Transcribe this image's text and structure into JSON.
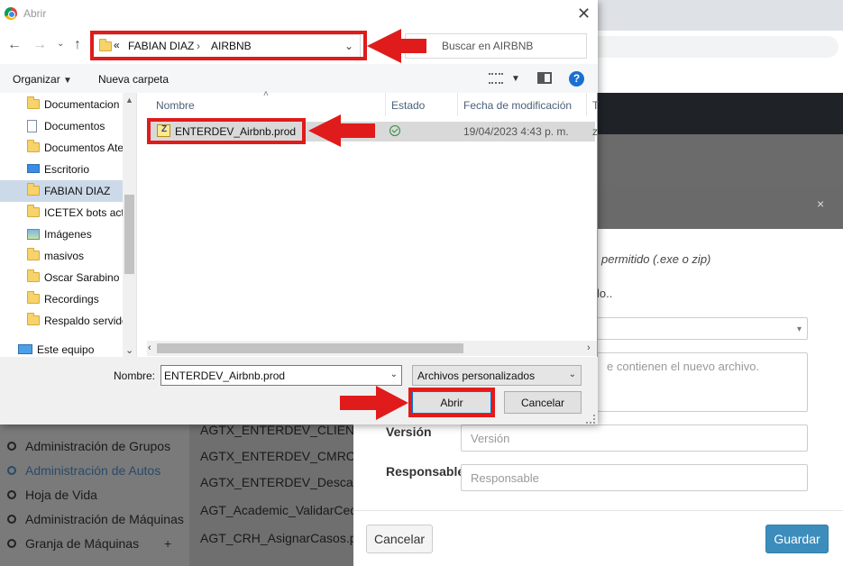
{
  "dialog": {
    "title": "Abrir",
    "path": {
      "prefix": "«",
      "segments": [
        "FABIAN DIAZ",
        "AIRBNB"
      ]
    },
    "search_placeholder": "Buscar en AIRBNB",
    "toolbar": {
      "organize": "Organizar",
      "new_folder": "Nueva carpeta"
    },
    "nav_items": [
      {
        "label": "Documentacion",
        "icon": "folder-icon"
      },
      {
        "label": "Documentos",
        "icon": "document-icon"
      },
      {
        "label": "Documentos Ate",
        "icon": "folder-icon"
      },
      {
        "label": "Escritorio",
        "icon": "desktop-icon"
      },
      {
        "label": "FABIAN DIAZ",
        "icon": "folder-icon",
        "selected": true
      },
      {
        "label": "ICETEX bots actu",
        "icon": "folder-icon"
      },
      {
        "label": "Imágenes",
        "icon": "pictures-icon"
      },
      {
        "label": "masivos",
        "icon": "folder-icon"
      },
      {
        "label": "Oscar Sarabino",
        "icon": "folder-icon"
      },
      {
        "label": "Recordings",
        "icon": "folder-icon"
      },
      {
        "label": "Respaldo servido",
        "icon": "folder-icon"
      },
      {
        "label": "Este equipo",
        "icon": "computer-icon"
      }
    ],
    "columns": {
      "name": "Nombre",
      "status": "Estado",
      "modified": "Fecha de modificación",
      "type": "T"
    },
    "files": [
      {
        "name": "ENTERDEV_Airbnb.prod",
        "status": "synced",
        "modified": "19/04/2023 4:43 p. m.",
        "type": "z"
      }
    ],
    "name_label": "Nombre:",
    "name_value": "ENTERDEV_Airbnb.prod",
    "file_type": "Archivos personalizados",
    "open_button": "Abrir",
    "cancel_button": "Cancelar"
  },
  "background": {
    "sidebar": [
      {
        "label": "Administración de Grupos"
      },
      {
        "label": "Administración de Autos",
        "active": true
      },
      {
        "label": "Hoja de Vida"
      },
      {
        "label": "Administración de Máquinas"
      },
      {
        "label": "Granja de Máquinas",
        "expand": "+"
      }
    ],
    "list": [
      "AGTX_ENTERDEV_CLIENTE",
      "AGTX_ENTERDEV_CMRCON",
      "AGTX_ENTERDEV_Descarga",
      "AGT_Academic_ValidarCedula",
      "AGT_CRH_AsignarCasos.prod"
    ],
    "modal": {
      "close": "×",
      "hint_allowed": "permitido (.exe o zip)",
      "hint_text": "lo..",
      "textarea_placeholder": "e contienen el nuevo archivo.",
      "version_label": "Versión",
      "version_placeholder": "Versión",
      "responsible_label": "Responsable",
      "responsible_placeholder": "Responsable",
      "cancel": "Cancelar",
      "save": "Guardar"
    }
  },
  "colors": {
    "annotation": "#e01b1b",
    "primary": "#3c8dbc"
  }
}
